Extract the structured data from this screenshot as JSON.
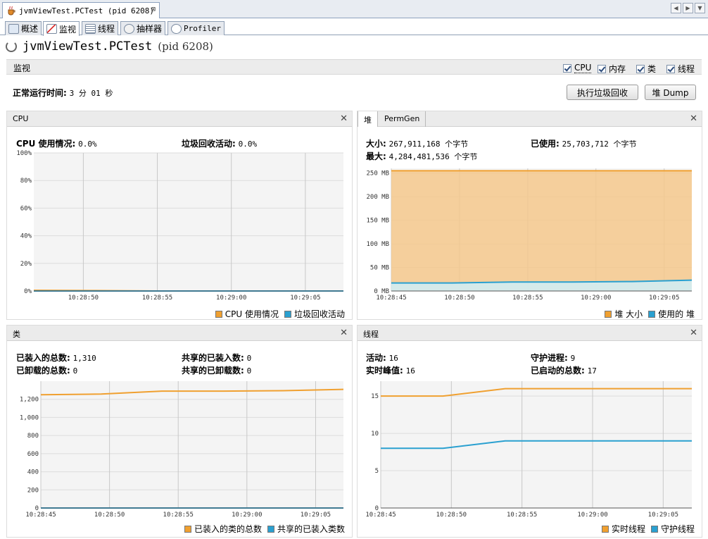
{
  "doc_tab": {
    "label": "jvmViewTest.PCTest (pid 6208)",
    "close": "⊠"
  },
  "view_tabs": [
    {
      "label": "概述",
      "icon": "overview-icon"
    },
    {
      "label": "监视",
      "icon": "monitor-icon"
    },
    {
      "label": "线程",
      "icon": "threads-icon"
    },
    {
      "label": "抽样器",
      "icon": "sampler-icon"
    },
    {
      "label": "Profiler",
      "icon": "profiler-icon"
    }
  ],
  "header": {
    "title": "jvmViewTest.PCTest",
    "pid": "(pid 6208)"
  },
  "section": {
    "label": "监视",
    "checkboxes": [
      "CPU",
      "内存",
      "类",
      "线程"
    ]
  },
  "uptime": {
    "label": "正常运行时间:",
    "value": "3 分 01 秒"
  },
  "buttons": {
    "gc": "执行垃圾回收",
    "heap_dump": "堆 Dump"
  },
  "cpu_panel": {
    "title": "CPU",
    "stats": [
      {
        "label": "CPU 使用情况:",
        "value": "0.0%"
      },
      {
        "label": "垃圾回收活动:",
        "value": "0.0%"
      }
    ],
    "legend": [
      "CPU 使用情况",
      "垃圾回收活动"
    ]
  },
  "heap_panel": {
    "tabs": [
      "堆",
      "PermGen"
    ],
    "stats": [
      {
        "label": "大小:",
        "value": "267,911,168 个字节"
      },
      {
        "label": "已使用:",
        "value": "25,703,712 个字节"
      },
      {
        "label": "最大:",
        "value": "4,284,481,536 个字节"
      }
    ],
    "legend": [
      "堆 大小",
      "使用的 堆"
    ]
  },
  "classes_panel": {
    "title": "类",
    "stats": [
      {
        "label": "已装入的总数:",
        "value": "1,310"
      },
      {
        "label": "共享的已装入数:",
        "value": "0"
      },
      {
        "label": "已卸载的总数:",
        "value": "0"
      },
      {
        "label": "共享的已卸载数:",
        "value": "0"
      }
    ],
    "legend": [
      "已装入的类的总数",
      "共享的已装入类数"
    ]
  },
  "threads_panel": {
    "title": "线程",
    "stats": [
      {
        "label": "活动:",
        "value": "16"
      },
      {
        "label": "守护进程:",
        "value": "9"
      },
      {
        "label": "实时峰值:",
        "value": "16"
      },
      {
        "label": "已启动的总数:",
        "value": "17"
      }
    ],
    "legend": [
      "实时线程",
      "守护线程"
    ]
  },
  "colors": {
    "orange": "#f0a030",
    "blue": "#2aa0d0",
    "heap_fill": "#f5c88c",
    "used_fill": "#cfeef8"
  },
  "chart_data": [
    {
      "type": "line",
      "title": "CPU",
      "y_ticks": [
        "100%",
        "80%",
        "60%",
        "40%",
        "20%",
        "0%"
      ],
      "x_ticks": [
        "10:28:50",
        "10:28:55",
        "10:29:00",
        "10:29:05"
      ],
      "series": [
        {
          "name": "CPU 使用情况",
          "values": [
            0.5,
            0.3,
            0,
            0,
            0,
            0
          ]
        },
        {
          "name": "垃圾回收活动",
          "values": [
            0,
            0,
            0,
            0,
            0,
            0
          ]
        }
      ],
      "ylim": [
        0,
        100
      ]
    },
    {
      "type": "area",
      "title": "堆",
      "y_ticks": [
        "250 MB",
        "200 MB",
        "150 MB",
        "100 MB",
        "50 MB",
        "0 MB"
      ],
      "x_ticks": [
        "10:28:45",
        "10:28:50",
        "10:28:55",
        "10:29:00",
        "10:29:05"
      ],
      "series": [
        {
          "name": "堆 大小",
          "values": [
            255,
            255,
            255,
            255,
            255,
            255
          ]
        },
        {
          "name": "使用的 堆",
          "values": [
            17,
            17,
            19,
            19,
            20,
            23
          ]
        }
      ],
      "ylim": [
        0,
        260
      ]
    },
    {
      "type": "line",
      "title": "类",
      "y_ticks": [
        "1,200",
        "1,000",
        "800",
        "600",
        "400",
        "200",
        "0"
      ],
      "x_ticks": [
        "10:28:45",
        "10:28:50",
        "10:28:55",
        "10:29:00",
        "10:29:05"
      ],
      "series": [
        {
          "name": "已装入的类的总数",
          "values": [
            1250,
            1258,
            1290,
            1290,
            1295,
            1310
          ]
        },
        {
          "name": "共享的已装入类数",
          "values": [
            0,
            0,
            0,
            0,
            0,
            0
          ]
        }
      ],
      "ylim": [
        0,
        1400
      ]
    },
    {
      "type": "line",
      "title": "线程",
      "y_ticks": [
        "15",
        "10",
        "5",
        "0"
      ],
      "x_ticks": [
        "10:28:45",
        "10:28:50",
        "10:28:55",
        "10:29:00",
        "10:29:05"
      ],
      "series": [
        {
          "name": "实时线程",
          "values": [
            15,
            15,
            16,
            16,
            16,
            16
          ]
        },
        {
          "name": "守护线程",
          "values": [
            8,
            8,
            9,
            9,
            9,
            9
          ]
        }
      ],
      "ylim": [
        0,
        17
      ]
    }
  ]
}
